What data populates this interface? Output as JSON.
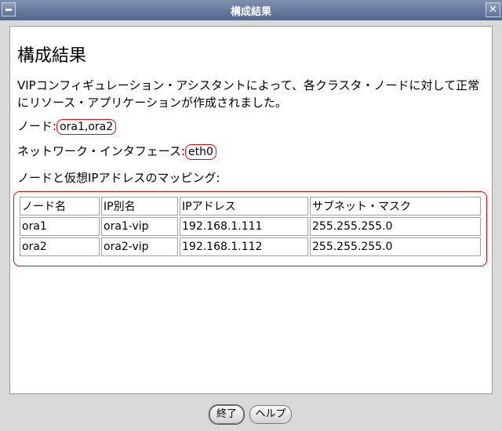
{
  "window": {
    "title": "構成結果"
  },
  "content": {
    "heading": "構成結果",
    "description": "VIPコンフィギュレーション・アシスタントによって、各クラスタ・ノードに対して正常にリソース・アプリケーションが作成されました。",
    "nodes_label": "ノード:",
    "nodes_value": "ora1,ora2",
    "interface_label": "ネットワーク・インタフェース:",
    "interface_value": "eth0",
    "mapping_label": "ノードと仮想IPアドレスのマッピング:"
  },
  "table": {
    "headers": [
      "ノード名",
      "IP別名",
      "IPアドレス",
      "サブネット・マスク"
    ],
    "rows": [
      [
        "ora1",
        "ora1-vip",
        "192.168.1.111",
        "255.255.255.0"
      ],
      [
        "ora2",
        "ora2-vip",
        "192.168.1.112",
        "255.255.255.0"
      ]
    ]
  },
  "buttons": {
    "finish": "終了",
    "help": "ヘルプ"
  }
}
